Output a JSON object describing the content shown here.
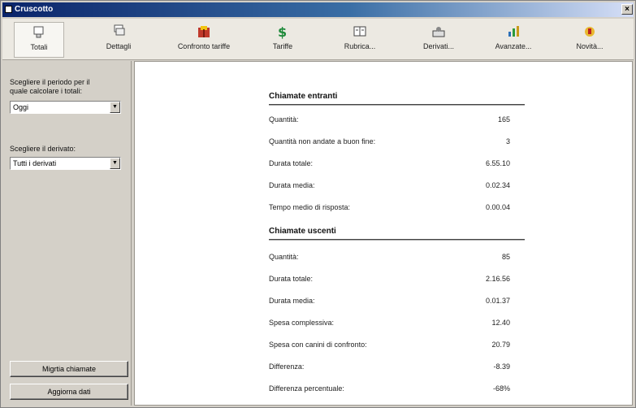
{
  "window": {
    "title": "Cruscotto",
    "close_glyph": "×"
  },
  "toolbar": [
    {
      "label": "Totali",
      "icon": "totals-icon"
    },
    {
      "label": "Dettagli",
      "icon": "details-icon"
    },
    {
      "label": "Confronto tariffe",
      "icon": "compare-rates-icon"
    },
    {
      "label": "Tariffe",
      "icon": "dollar-icon"
    },
    {
      "label": "Rubrica...",
      "icon": "address-book-icon"
    },
    {
      "label": "Derivati...",
      "icon": "extensions-icon"
    },
    {
      "label": "Avanzate...",
      "icon": "advanced-chart-icon"
    },
    {
      "label": "Novità...",
      "icon": "news-icon"
    }
  ],
  "sidebar": {
    "period_label_1": "Scegliere il periodo per il",
    "period_label_2": "quale calcolare i totali:",
    "period_value": "Oggi",
    "extension_label": "Scegliere il derivato:",
    "extension_value": "Tutti i derivati",
    "import_button": "Migrtia chiamate",
    "refresh_button": "Aggiorna dati"
  },
  "outgoing": {
    "title": "Chiamate entranti",
    "rows": [
      {
        "label": "Quantità:",
        "value": "165"
      },
      {
        "label": "Quantità non andate a buon fine:",
        "value": "3"
      },
      {
        "label": "Durata totale:",
        "value": "6.55.10"
      },
      {
        "label": "Durata media:",
        "value": "0.02.34"
      },
      {
        "label": "Tempo medio di risposta:",
        "value": "0.00.04"
      }
    ]
  },
  "incoming": {
    "title": "Chiamate uscenti",
    "rows": [
      {
        "label": "Quantità:",
        "value": "85"
      },
      {
        "label": "Durata totale:",
        "value": "2.16.56"
      },
      {
        "label": "Durata media:",
        "value": "0.01.37"
      },
      {
        "label": "Spesa complessiva:",
        "value": "12.40"
      },
      {
        "label": "Spesa con canini di confronto:",
        "value": "20.79"
      },
      {
        "label": "Differenza:",
        "value": "-8.39"
      },
      {
        "label": "Differenza percentuale:",
        "value": "-68%"
      }
    ]
  }
}
